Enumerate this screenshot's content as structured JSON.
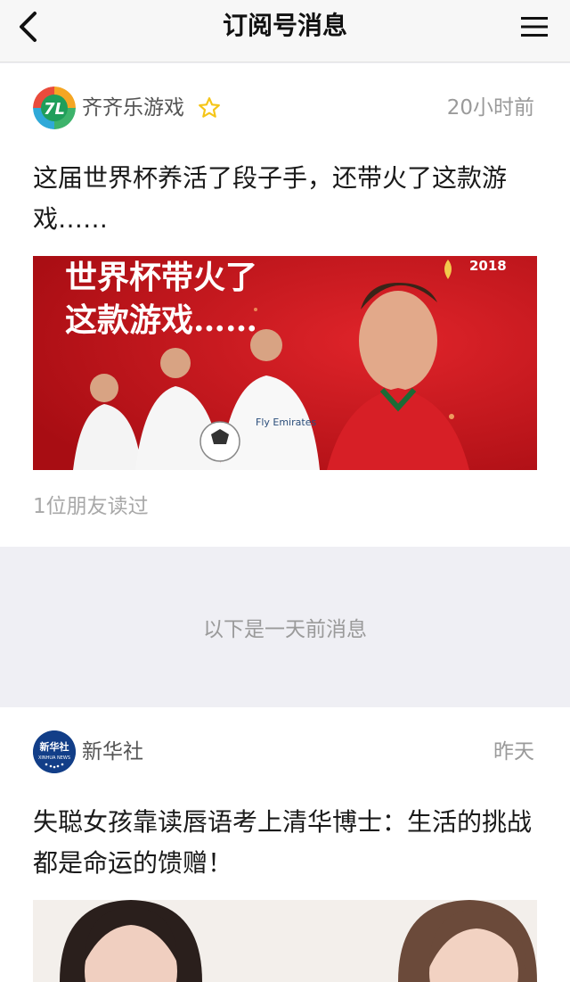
{
  "nav": {
    "title": "订阅号消息",
    "back_icon": "chevron-left-icon",
    "menu_icon": "hamburger-menu-icon"
  },
  "messages": [
    {
      "publisher": "齐齐乐游戏",
      "avatar_text": "7L",
      "starred": true,
      "time": "20小时前",
      "title": "这届世界杯养活了段子手，还带火了这款游戏……",
      "image": {
        "headline_1": "世界杯带火了",
        "headline_2": "这款游戏……",
        "year": "2018",
        "jersey_text": "Fly Emirates"
      },
      "read_note": "1位朋友读过"
    },
    {
      "publisher": "新华社",
      "avatar_text": "新华社",
      "avatar_subtext": "XINHUA NEWS",
      "time": "昨天",
      "title": "失聪女孩靠读唇语考上清华博士：生活的挑战都是命运的馈赠！"
    }
  ],
  "divider_text": "以下是一天前消息",
  "colors": {
    "nav_bg": "#f7f7f7",
    "page_bg": "#efeff4",
    "star": "#f5c518",
    "banner_red": "#c8141b"
  }
}
